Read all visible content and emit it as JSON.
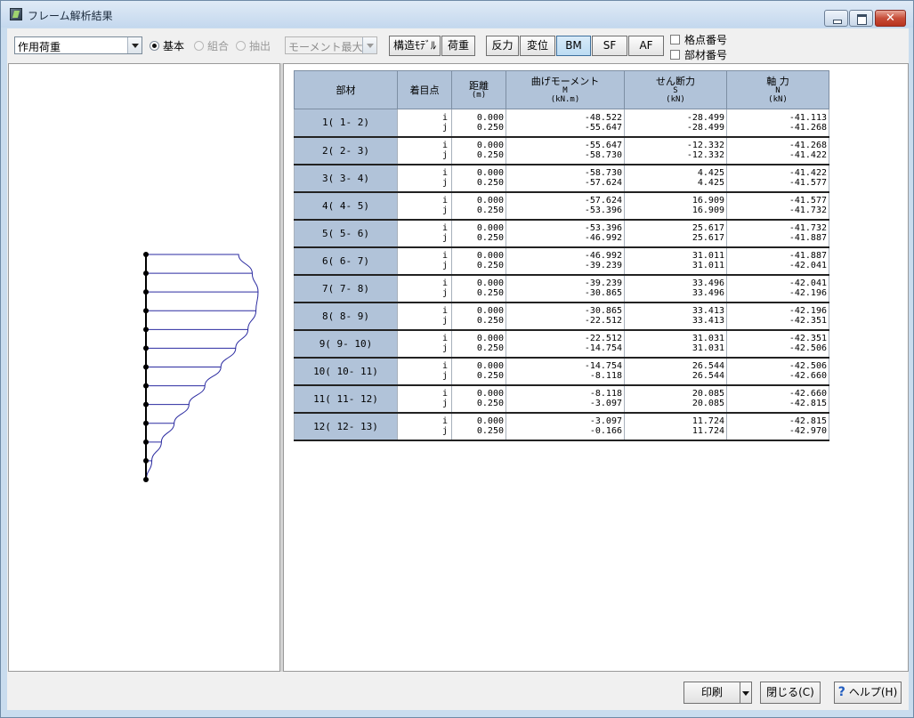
{
  "window": {
    "title": "フレーム解析結果"
  },
  "toolbar": {
    "load_case": "作用荷重",
    "radios": [
      {
        "label": "基本",
        "selected": true,
        "enabled": true
      },
      {
        "label": "組合",
        "selected": false,
        "enabled": false
      },
      {
        "label": "抽出",
        "selected": false,
        "enabled": false
      }
    ],
    "extract_mode": "モーメント最大",
    "buttons": {
      "structure_model": "構造ﾓﾃﾞﾙ",
      "load": "荷重",
      "reaction": "反力",
      "displacement": "変位",
      "bm": "BM",
      "sf": "SF",
      "af": "AF"
    },
    "active_diagram": "BM",
    "checkboxes": {
      "node_numbers": {
        "label": "格点番号",
        "checked": false
      },
      "member_numbers": {
        "label": "部材番号",
        "checked": false
      }
    }
  },
  "table": {
    "headers": {
      "member": "部材",
      "point": "着目点",
      "distance": "距離",
      "distance_unit": "(m)",
      "moment": "曲げモーメント",
      "moment_symbol": "M",
      "moment_unit": "(kN.m)",
      "shear": "せん断力",
      "shear_symbol": "S",
      "shear_unit": "(kN)",
      "axial": "軸 力",
      "axial_symbol": "N",
      "axial_unit": "(kN)"
    },
    "rows": [
      {
        "member": "1( 1- 2)",
        "pi": "i",
        "pj": "j",
        "di": "0.000",
        "dj": "0.250",
        "mi": "-48.522",
        "mj": "-55.647",
        "si": "-28.499",
        "sj": "-28.499",
        "ni": "-41.113",
        "nj": "-41.268"
      },
      {
        "member": "2( 2- 3)",
        "pi": "i",
        "pj": "j",
        "di": "0.000",
        "dj": "0.250",
        "mi": "-55.647",
        "mj": "-58.730",
        "si": "-12.332",
        "sj": "-12.332",
        "ni": "-41.268",
        "nj": "-41.422"
      },
      {
        "member": "3( 3- 4)",
        "pi": "i",
        "pj": "j",
        "di": "0.000",
        "dj": "0.250",
        "mi": "-58.730",
        "mj": "-57.624",
        "si": "4.425",
        "sj": "4.425",
        "ni": "-41.422",
        "nj": "-41.577"
      },
      {
        "member": "4( 4- 5)",
        "pi": "i",
        "pj": "j",
        "di": "0.000",
        "dj": "0.250",
        "mi": "-57.624",
        "mj": "-53.396",
        "si": "16.909",
        "sj": "16.909",
        "ni": "-41.577",
        "nj": "-41.732"
      },
      {
        "member": "5( 5- 6)",
        "pi": "i",
        "pj": "j",
        "di": "0.000",
        "dj": "0.250",
        "mi": "-53.396",
        "mj": "-46.992",
        "si": "25.617",
        "sj": "25.617",
        "ni": "-41.732",
        "nj": "-41.887"
      },
      {
        "member": "6( 6- 7)",
        "pi": "i",
        "pj": "j",
        "di": "0.000",
        "dj": "0.250",
        "mi": "-46.992",
        "mj": "-39.239",
        "si": "31.011",
        "sj": "31.011",
        "ni": "-41.887",
        "nj": "-42.041"
      },
      {
        "member": "7( 7- 8)",
        "pi": "i",
        "pj": "j",
        "di": "0.000",
        "dj": "0.250",
        "mi": "-39.239",
        "mj": "-30.865",
        "si": "33.496",
        "sj": "33.496",
        "ni": "-42.041",
        "nj": "-42.196"
      },
      {
        "member": "8( 8- 9)",
        "pi": "i",
        "pj": "j",
        "di": "0.000",
        "dj": "0.250",
        "mi": "-30.865",
        "mj": "-22.512",
        "si": "33.413",
        "sj": "33.413",
        "ni": "-42.196",
        "nj": "-42.351"
      },
      {
        "member": "9( 9- 10)",
        "pi": "i",
        "pj": "j",
        "di": "0.000",
        "dj": "0.250",
        "mi": "-22.512",
        "mj": "-14.754",
        "si": "31.031",
        "sj": "31.031",
        "ni": "-42.351",
        "nj": "-42.506"
      },
      {
        "member": "10( 10- 11)",
        "pi": "i",
        "pj": "j",
        "di": "0.000",
        "dj": "0.250",
        "mi": "-14.754",
        "mj": "-8.118",
        "si": "26.544",
        "sj": "26.544",
        "ni": "-42.506",
        "nj": "-42.660"
      },
      {
        "member": "11( 11- 12)",
        "pi": "i",
        "pj": "j",
        "di": "0.000",
        "dj": "0.250",
        "mi": "-8.118",
        "mj": "-3.097",
        "si": "20.085",
        "sj": "20.085",
        "ni": "-42.660",
        "nj": "-42.815"
      },
      {
        "member": "12( 12- 13)",
        "pi": "i",
        "pj": "j",
        "di": "0.000",
        "dj": "0.250",
        "mi": "-3.097",
        "mj": "-0.166",
        "si": "11.724",
        "sj": "11.724",
        "ni": "-42.815",
        "nj": "-42.970"
      }
    ]
  },
  "footer": {
    "print": "印刷",
    "close": "閉じる(C)",
    "help": "ヘルプ(H)"
  },
  "colors": {
    "header_bg": "#b1c3d9",
    "diagram_line": "#2a2aa0",
    "member_line": "#000000"
  }
}
